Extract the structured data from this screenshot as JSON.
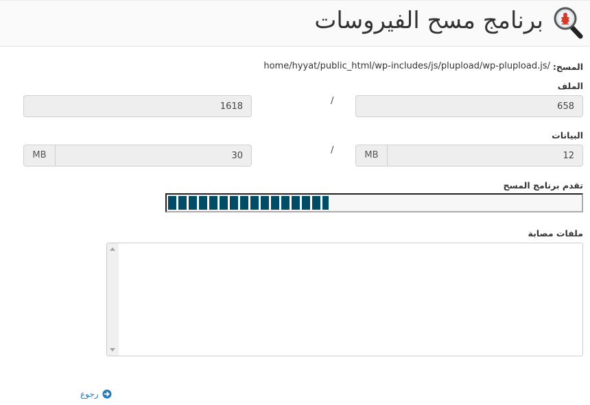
{
  "header": {
    "title": "برنامج مسح الفيروسات",
    "icon": "magnifier-bug-icon"
  },
  "scan": {
    "label": "المسح:",
    "path": "home/hyyat/public_html/wp-includes/js/plupload/wp-plupload.js/"
  },
  "files": {
    "label": "الملف",
    "scanned": "658",
    "separator": "/",
    "total": "1618"
  },
  "data": {
    "label": "البيانات",
    "scanned": "12",
    "total": "30",
    "unit": "MB",
    "separator": "/"
  },
  "progress": {
    "label": "تقدم برنامج المسح",
    "percent": 39,
    "color": "#004b66"
  },
  "infected": {
    "label": "ملفات مصابة",
    "value": ""
  },
  "footer": {
    "back_label": "رجوع",
    "back_icon": "circle-arrow-right-icon"
  }
}
